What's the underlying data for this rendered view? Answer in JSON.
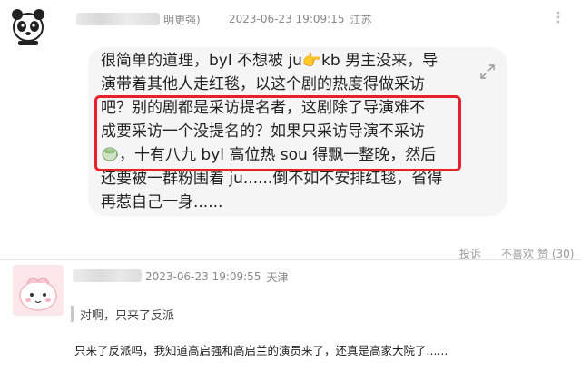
{
  "comment1": {
    "username_suffix": "明更强)",
    "timestamp": "2023-06-23 19:09:15",
    "location": "江苏",
    "lines": [
      "很简单的道理，byl 不想被 ju👉kb 男主没来，导",
      "演带着其他人走红毯，以这个剧的热度得做采访",
      "吧？别的剧都是采访提名者，这剧除了导演难不",
      "成要采访一个没提名的？如果只采访导演不采访",
      "，十有八九 byl 高位热 sou 得飘一整晚，然后",
      "还要被一群粉围着 ju......倒不如不安排红毯，省得",
      "再惹自己一身......"
    ],
    "actions": {
      "report": "投诉",
      "dislike": "不喜欢",
      "like": "赞 (30)"
    }
  },
  "comment2": {
    "timestamp": "2023-06-23 19:09:55",
    "location": "天津",
    "quote": "对啊，只来了反派",
    "reply": "只来了反派吗，我知道高启强和高启兰的演员来了，还真是高家大院了......"
  },
  "colors": {
    "highlight": "#e8202a",
    "bubble_bg": "#f5f5f5",
    "meta_text": "#888888"
  }
}
